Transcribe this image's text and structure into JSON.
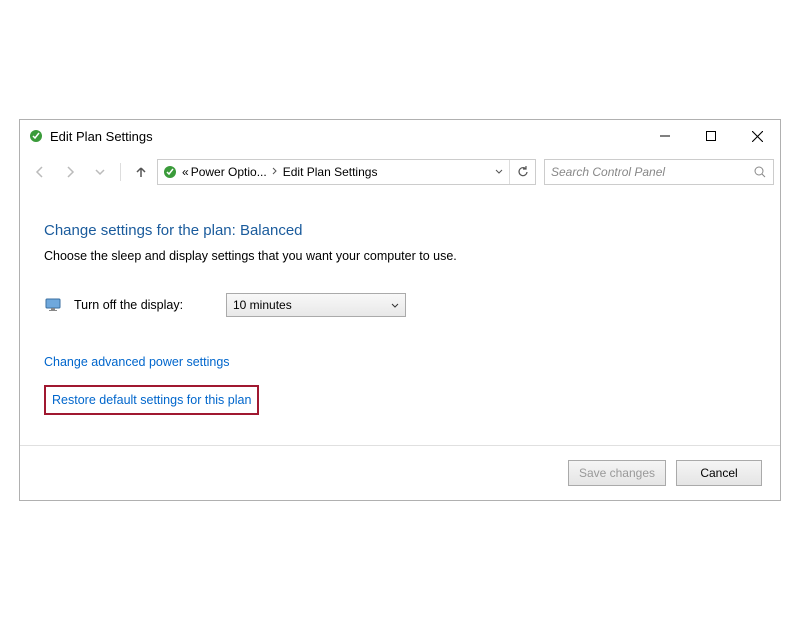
{
  "window": {
    "title": "Edit Plan Settings"
  },
  "breadcrumb": {
    "prefix": "«",
    "item1": "Power Optio...",
    "item2": "Edit Plan Settings"
  },
  "search": {
    "placeholder": "Search Control Panel"
  },
  "content": {
    "heading": "Change settings for the plan: Balanced",
    "subtext": "Choose the sleep and display settings that you want your computer to use.",
    "display_label": "Turn off the display:",
    "display_value": "10 minutes",
    "link_advanced": "Change advanced power settings",
    "link_restore": "Restore default settings for this plan"
  },
  "footer": {
    "save": "Save changes",
    "cancel": "Cancel"
  }
}
